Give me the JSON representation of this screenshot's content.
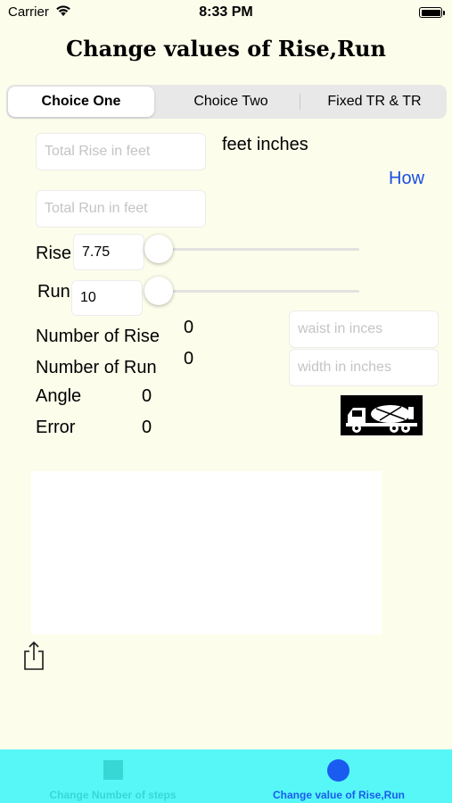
{
  "status_bar": {
    "carrier": "Carrier",
    "time": "8:33 PM"
  },
  "title": "Change values of Rise,Run",
  "segmented": {
    "options": [
      "Choice One",
      "Choice Two",
      "Fixed TR & TR"
    ],
    "selected": "Choice One"
  },
  "inputs": {
    "total_rise_placeholder": "Total Rise in feet",
    "total_run_placeholder": "Total Run in feet",
    "rise_value": "7.75",
    "run_value": "10",
    "waist_placeholder": "waist in inces",
    "width_placeholder": "width in inches"
  },
  "labels": {
    "feet_inches": "feet inches",
    "how": "How",
    "rise": "Rise",
    "run": "Run",
    "number_of_rise": "Number of Rise",
    "number_of_run": "Number of Run",
    "angle": "Angle",
    "error": "Error"
  },
  "values": {
    "number_of_rise": "0",
    "number_of_run": "0",
    "angle": "0",
    "error": "0"
  },
  "sliders": {
    "rise_level": 0,
    "run_level": 0
  },
  "icons": {
    "wifi": "wifi-icon",
    "battery": "battery-icon",
    "truck": "cement-truck-icon",
    "share": "share-icon",
    "tab1": "square-icon",
    "tab2": "circle-icon"
  },
  "tabbar": {
    "tabs": [
      {
        "label": "Change Number of steps",
        "color": "#39d6d6"
      },
      {
        "label": "Change value of Rise,Run",
        "color": "#1a5cf0"
      }
    ],
    "background": "#57f7f7"
  },
  "colors": {
    "background": "#fdfdeb",
    "link": "#1a4fe0"
  }
}
